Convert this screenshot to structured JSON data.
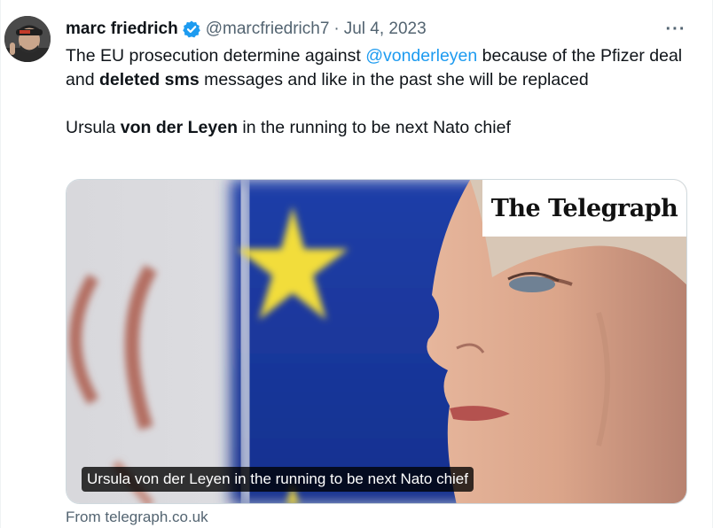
{
  "author": {
    "display_name": "marc friedrich",
    "handle": "@marcfriedrich7",
    "separator": "·",
    "date": "Jul 4, 2023",
    "verified_color": "#1d9bf0",
    "verified_icon": "verified-badge-icon"
  },
  "more_icon": "more-options-icon",
  "tweet": {
    "line1_a": "The EU prosecution determine against ",
    "mention": "@vonderleyen",
    "line1_b": " because of the Pfizer deal and ",
    "bold_1": "deleted sms",
    "line1_c": " messages and like in the past she will be replaced",
    "line2_a": "Ursula ",
    "bold_2": "von der Leyen",
    "line2_b": " in the running to be next Nato chief"
  },
  "card": {
    "masthead": "The Telegraph",
    "caption": "Ursula von der Leyen in the running to be next Nato chief",
    "source": "From telegraph.co.uk"
  },
  "colors": {
    "text": "#0f1419",
    "secondary": "#536471",
    "link": "#1d9bf0",
    "eu_blue": "#1a3aa8",
    "eu_star": "#f2dd3a"
  }
}
